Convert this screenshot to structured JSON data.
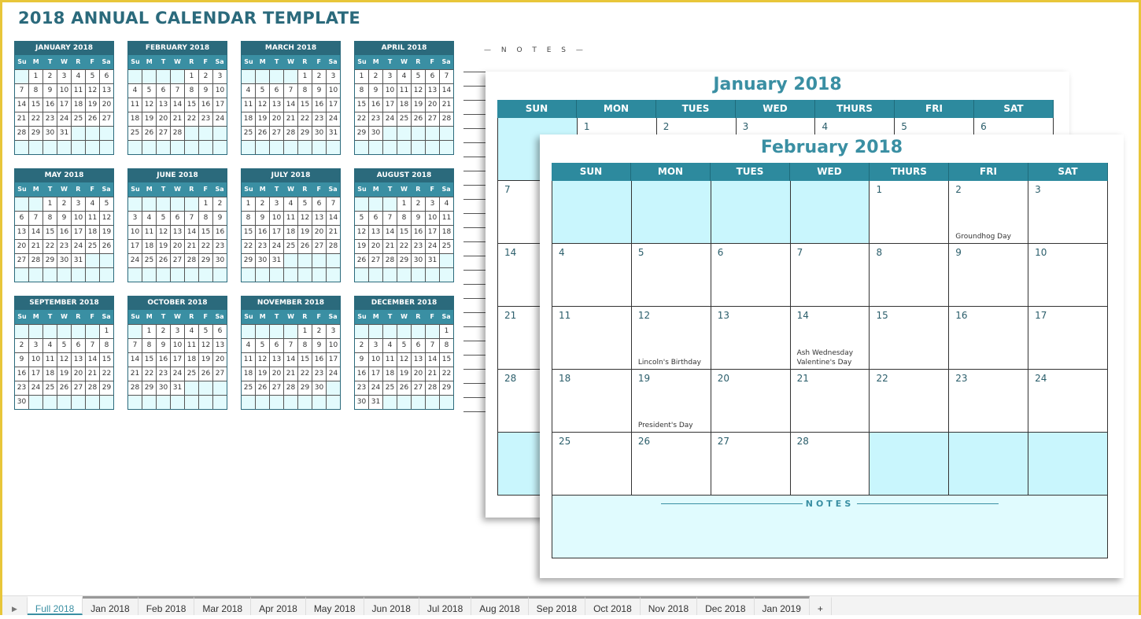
{
  "title": "2018 ANNUAL CALENDAR TEMPLATE",
  "weekdays_short": [
    "Su",
    "M",
    "T",
    "W",
    "R",
    "F",
    "Sa"
  ],
  "months": [
    {
      "label": "JANUARY 2018",
      "first_weekday": 1,
      "days": 31
    },
    {
      "label": "FEBRUARY 2018",
      "first_weekday": 4,
      "days": 28
    },
    {
      "label": "MARCH 2018",
      "first_weekday": 4,
      "days": 31
    },
    {
      "label": "APRIL 2018",
      "first_weekday": 0,
      "days": 30
    },
    {
      "label": "MAY 2018",
      "first_weekday": 2,
      "days": 31
    },
    {
      "label": "JUNE 2018",
      "first_weekday": 5,
      "days": 30
    },
    {
      "label": "JULY 2018",
      "first_weekday": 0,
      "days": 31
    },
    {
      "label": "AUGUST 2018",
      "first_weekday": 3,
      "days": 31
    },
    {
      "label": "SEPTEMBER 2018",
      "first_weekday": 6,
      "days": 30
    },
    {
      "label": "OCTOBER 2018",
      "first_weekday": 1,
      "days": 31
    },
    {
      "label": "NOVEMBER 2018",
      "first_weekday": 4,
      "days": 30
    },
    {
      "label": "DECEMBER 2018",
      "first_weekday": 6,
      "days": 31
    }
  ],
  "notes_label": "— N O T E S —",
  "weekdays_long": [
    "SUN",
    "MON",
    "TUES",
    "WED",
    "THURS",
    "FRI",
    "SAT"
  ],
  "sheets": [
    {
      "title": "January 2018",
      "first_weekday": 1,
      "days": 31,
      "events": {}
    },
    {
      "title": "February 2018",
      "first_weekday": 4,
      "days": 28,
      "events": {
        "2": [
          "Groundhog Day"
        ],
        "12": [
          "Lincoln's Birthday"
        ],
        "14": [
          "Ash Wednesday",
          "Valentine's Day"
        ],
        "19": [
          "President's Day"
        ]
      },
      "notes": "NOTES"
    }
  ],
  "tabs": [
    "Full 2018",
    "Jan 2018",
    "Feb 2018",
    "Mar 2018",
    "Apr 2018",
    "May 2018",
    "Jun 2018",
    "Jul 2018",
    "Aug 2018",
    "Sep 2018",
    "Oct 2018",
    "Nov 2018",
    "Dec 2018",
    "Jan 2019"
  ],
  "active_tab": "Full 2018",
  "colors": {
    "dark_teal": "#2b6a7c",
    "teal": "#2d8a9e",
    "light_cyan": "#c9f6fd",
    "frame": "#e8c63a"
  }
}
